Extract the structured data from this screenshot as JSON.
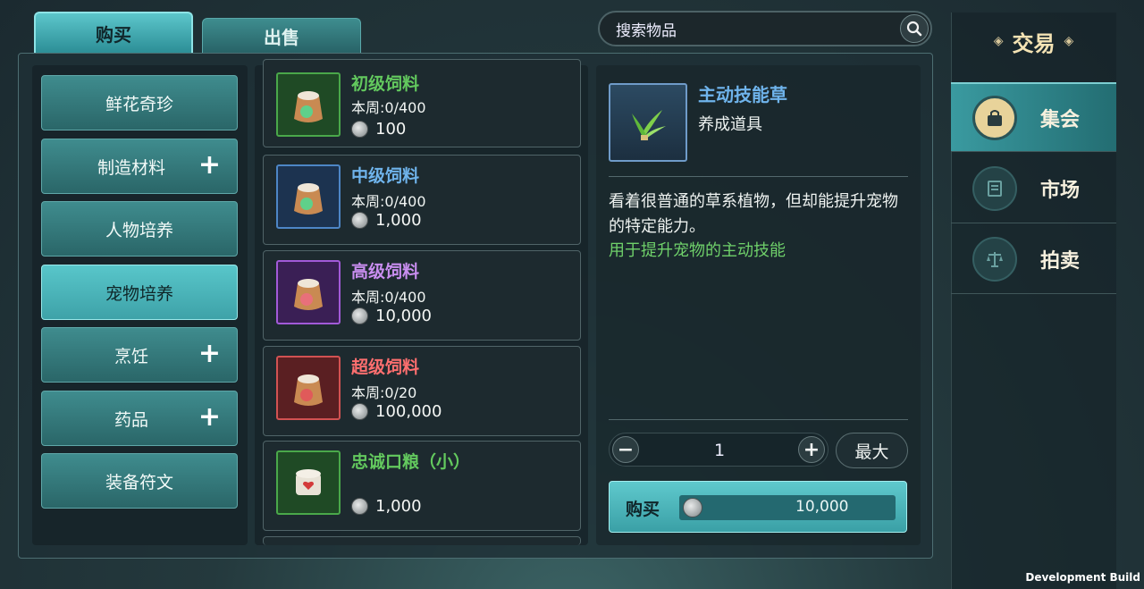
{
  "tabs": {
    "buy": "购买",
    "sell": "出售"
  },
  "search": {
    "placeholder": "搜索物品",
    "icon": "search-icon"
  },
  "categories": [
    {
      "label": "鲜花奇珍",
      "plus": false,
      "active": false
    },
    {
      "label": "制造材料",
      "plus": true,
      "active": false
    },
    {
      "label": "人物培养",
      "plus": false,
      "active": false
    },
    {
      "label": "宠物培养",
      "plus": false,
      "active": true
    },
    {
      "label": "烹饪",
      "plus": true,
      "active": false
    },
    {
      "label": "药品",
      "plus": true,
      "active": false
    },
    {
      "label": "装备符文",
      "plus": false,
      "active": false
    }
  ],
  "plus_symbol": "+",
  "items": [
    {
      "name": "初级饲料",
      "limit": "本周:0/400",
      "price": "100",
      "color": "#63c95e",
      "frame": "#4aa84a",
      "bg": "#1f4a25"
    },
    {
      "name": "中级饲料",
      "limit": "本周:0/400",
      "price": "1,000",
      "color": "#6fb4ec",
      "frame": "#4d86c6",
      "bg": "#1c3350"
    },
    {
      "name": "高级饲料",
      "limit": "本周:0/400",
      "price": "10,000",
      "color": "#c98ef0",
      "frame": "#a25ad8",
      "bg": "#3a1f55"
    },
    {
      "name": "超级饲料",
      "limit": "本周:0/20",
      "price": "100,000",
      "color": "#ff6f6f",
      "frame": "#d25252",
      "bg": "#5a1f22"
    },
    {
      "name": "忠诚口粮（小）",
      "limit": "",
      "price": "1,000",
      "color": "#63c95e",
      "frame": "#4aa84a",
      "bg": "#1f4a25"
    }
  ],
  "detail": {
    "name": "主动技能草",
    "type": "养成道具",
    "description": "看着很普通的草系植物，但却能提升宠物的特定能力。",
    "effect": "用于提升宠物的主动技能",
    "quantity": "1",
    "minus": "−",
    "plus": "+",
    "max_label": "最大",
    "buy_label": "购买",
    "total_price": "10,000"
  },
  "right_nav": {
    "title": "交易",
    "ornament": "◈",
    "items": [
      {
        "label": "集会",
        "icon": "bag-icon",
        "active": true
      },
      {
        "label": "市场",
        "icon": "stall-icon",
        "active": false
      },
      {
        "label": "拍卖",
        "icon": "scales-icon",
        "active": false
      }
    ]
  },
  "footer": {
    "build_label": "Development Build"
  }
}
